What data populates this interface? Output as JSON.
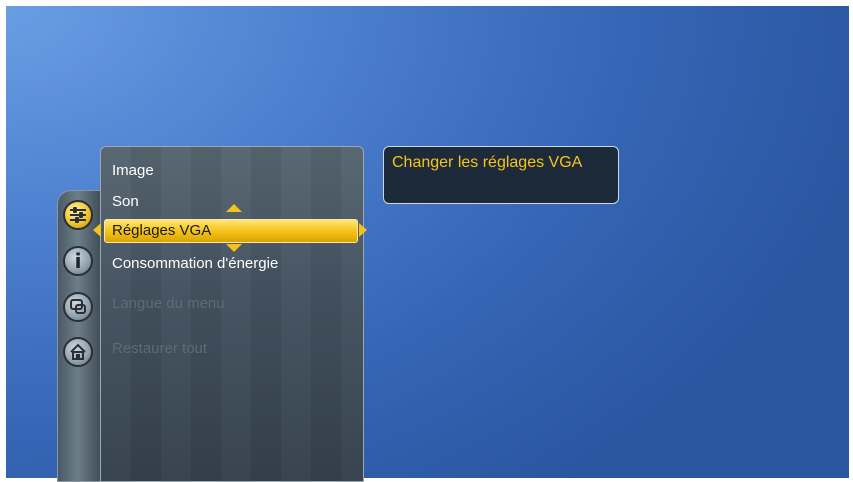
{
  "menu": {
    "items": [
      {
        "label": "Image",
        "state": "normal"
      },
      {
        "label": "Son",
        "state": "normal"
      },
      {
        "label": "Réglages VGA",
        "state": "selected"
      },
      {
        "label": "Consommation d'énergie",
        "state": "normal"
      },
      {
        "label": "Langue du menu",
        "state": "disabled"
      },
      {
        "label": "Restaurer tout",
        "state": "disabled"
      }
    ]
  },
  "side_icons": [
    {
      "name": "settings-icon",
      "state": "active"
    },
    {
      "name": "info-icon",
      "state": "normal"
    },
    {
      "name": "language-icon",
      "state": "normal"
    },
    {
      "name": "home-icon",
      "state": "normal"
    }
  ],
  "help": {
    "text": "Changer les réglages VGA"
  },
  "colors": {
    "highlight": "#f6c419",
    "help_text": "#f6c51a",
    "background": "#3565b5"
  }
}
